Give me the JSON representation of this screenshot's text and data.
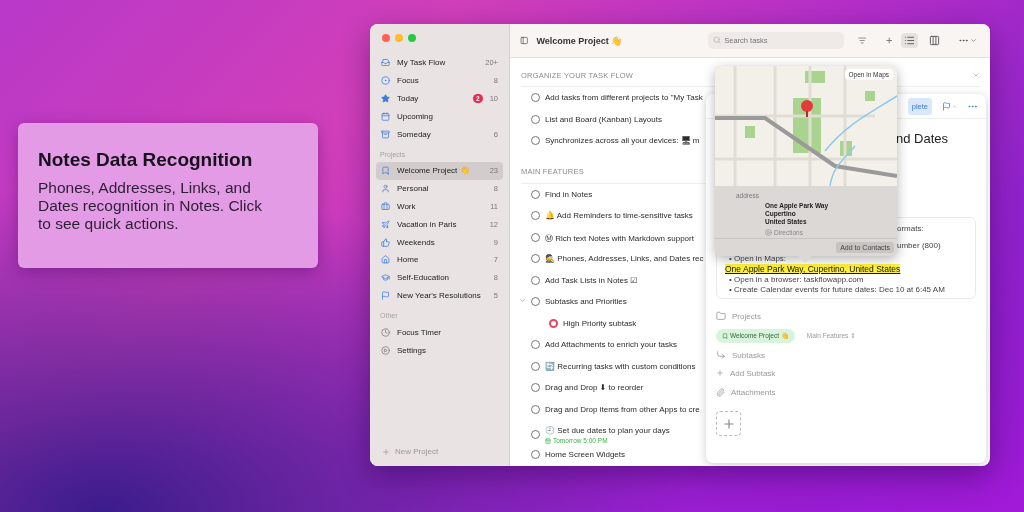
{
  "promo": {
    "title": "Notes Data Recognition",
    "body": "Phones, Addresses, Links, and Dates recognition in Notes. Click to see quick actions."
  },
  "sidebar": {
    "smart_lists": [
      {
        "label": "My Task Flow",
        "count": "20+",
        "selected": false
      },
      {
        "label": "Focus",
        "count": "8",
        "selected": false
      },
      {
        "label": "Today",
        "badge": "2",
        "count": "10",
        "selected": false
      },
      {
        "label": "Upcoming",
        "selected": false
      },
      {
        "label": "Someday",
        "count": "6",
        "selected": false
      }
    ],
    "projects_heading": "Projects",
    "projects": [
      {
        "label": "Welcome Project 👋",
        "count": "23",
        "selected": true
      },
      {
        "label": "Personal",
        "count": "8",
        "selected": false
      },
      {
        "label": "Work",
        "count": "11",
        "selected": false
      },
      {
        "label": "Vacation in Paris",
        "count": "12",
        "selected": false
      },
      {
        "label": "Weekends",
        "count": "9",
        "selected": false
      },
      {
        "label": "Home",
        "count": "7",
        "selected": false
      },
      {
        "label": "Self-Education",
        "count": "8",
        "selected": false
      },
      {
        "label": "New Year's Resolutions",
        "count": "5",
        "selected": false
      }
    ],
    "other_heading": "Other",
    "other": [
      {
        "label": "Focus Timer",
        "selected": false
      },
      {
        "label": "Settings",
        "selected": false
      }
    ],
    "new_project": "New Project"
  },
  "toolbar": {
    "title": "Welcome Project 👋",
    "search": {
      "placeholder": "Search tasks"
    },
    "views": [
      {
        "kind": "list",
        "selected": true
      },
      {
        "kind": "board",
        "selected": false
      }
    ]
  },
  "sections": [
    {
      "heading": "ORGANIZE YOUR TASK FLOW",
      "expanded": true,
      "tasks": [
        {
          "title": "Add tasks from different projects to \"My Task",
          "checked": false
        },
        {
          "title": "List and Board (Kanban) Layouts",
          "checked": false
        },
        {
          "title": "Synchronizes across all your devices: 🖥 m",
          "checked": false
        }
      ]
    },
    {
      "heading": "MAIN FEATURES",
      "tasks": [
        {
          "title": "Find in Notes",
          "checked": false
        },
        {
          "title": "🔔 Add Reminders to time-sensitive tasks",
          "checked": false
        },
        {
          "title": "Ⓜ Rich text Notes with Markdown support",
          "checked": false
        },
        {
          "title": "🕵 Phones, Addresses, Links, and Dates rec",
          "checked": false
        },
        {
          "title": "Add Task Lists in Notes ☑",
          "checked": false
        },
        {
          "title": "Subtasks and Priorities",
          "checked": false,
          "expanded": true,
          "children": [
            {
              "title": "High Priority subtask",
              "color": "#e8475f"
            }
          ]
        },
        {
          "title": "Add Attachments to enrich your tasks",
          "checked": false
        },
        {
          "title": "🔄 Recurring tasks with custom conditions",
          "checked": false
        },
        {
          "title": "Drag and Drop ⬇ to reorder",
          "checked": false
        },
        {
          "title": "Drag and Drop items from other Apps to cre",
          "checked": false
        },
        {
          "title": "🕘 Set due dates to plan your days",
          "checked": false,
          "due": "Tomorrow 5:00 PM"
        },
        {
          "title": "Home Screen Widgets",
          "checked": false
        }
      ]
    }
  ],
  "detail": {
    "complete_button": "plete",
    "title_fragment": "nd Dates",
    "note": {
      "fragments": [
        "ormats:",
        "umber (800)"
      ],
      "lines": [
        "• Open in Maps:"
      ],
      "address_link": "One Apple Park Way, Cupertino, United States",
      "bullets": [
        "• Open in a browser: taskflowapp.com",
        "• Create Calendar events for future dates: Dec 10 at 6:45 AM"
      ]
    },
    "projects_label": "Projects",
    "project_chip": "Welcome Project 👋",
    "section_picker": "Main Features ⇕",
    "subtasks_label": "Subtasks",
    "add_subtask": "Add Subtask",
    "attachments_label": "Attachments"
  },
  "map_popover": {
    "open_in_maps": "Open in Maps",
    "address_label": "address",
    "address_lines": [
      "One Apple Park Way",
      "Cupertino",
      "United States"
    ],
    "directions": "Directions",
    "add_to_contacts": "Add to Contacts"
  }
}
